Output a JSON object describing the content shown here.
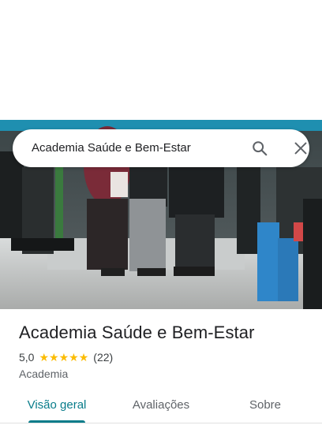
{
  "search": {
    "query": "Academia Saúde e Bem-Estar",
    "search_icon": "search-icon",
    "close_icon": "close-icon"
  },
  "place": {
    "photo_icon": "gym-photo",
    "name": "Academia Saúde e Bem-Estar",
    "rating": "5,0",
    "stars": 5,
    "review_count": "(22)",
    "category": "Academia"
  },
  "tabs": [
    {
      "label": "Visão geral",
      "active": true
    },
    {
      "label": "Avaliações",
      "active": false
    },
    {
      "label": "Sobre",
      "active": false
    }
  ],
  "colors": {
    "accent": "#087c8a",
    "star": "#fbbc04"
  }
}
